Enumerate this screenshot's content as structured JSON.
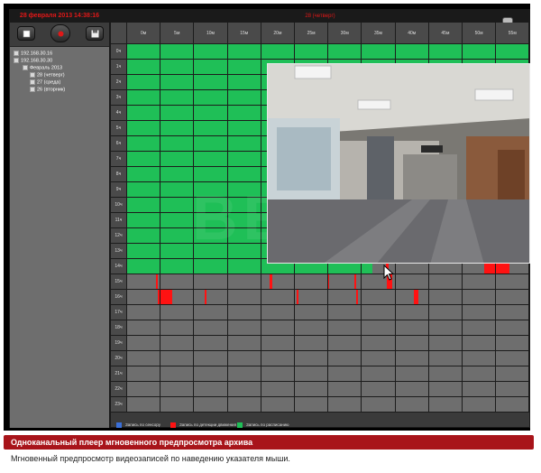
{
  "datetime": "28 февраля 2013 14:38:16",
  "day_header": "28 (четверг)",
  "tree": [
    {
      "label": "192.168.30.16",
      "level": 0
    },
    {
      "label": "192.168.30.30",
      "level": 0
    },
    {
      "label": "Февраль 2013",
      "level": 1
    },
    {
      "label": "28 (четверг)",
      "level": 2
    },
    {
      "label": "27 (среда)",
      "level": 2
    },
    {
      "label": "26 (вторник)",
      "level": 2
    }
  ],
  "columns": [
    "0м",
    "5м",
    "10м",
    "15м",
    "20м",
    "25м",
    "30м",
    "35м",
    "40м",
    "45м",
    "50м",
    "55м"
  ],
  "rows": [
    "0ч",
    "1ч",
    "2ч",
    "3ч",
    "4ч",
    "5ч",
    "6ч",
    "7ч",
    "8ч",
    "9ч",
    "10ч",
    "11ч",
    "12ч",
    "13ч",
    "14ч",
    "15ч",
    "16ч",
    "17ч",
    "18ч",
    "19ч",
    "20ч",
    "21ч",
    "22ч",
    "23ч"
  ],
  "legend": [
    {
      "label": "Запись по сенсору",
      "color": "#3a6fd8"
    },
    {
      "label": "Запись по детекции движения",
      "color": "#ff1212"
    },
    {
      "label": "Запись по расписанию",
      "color": "#1fbf57"
    }
  ],
  "watermark": "BEWARD",
  "banner": "Одноканальный плеер мгновенного предпросмотра архива",
  "description": "Мгновенный предпросмотр видеозаписей по наведению указателя мыши."
}
